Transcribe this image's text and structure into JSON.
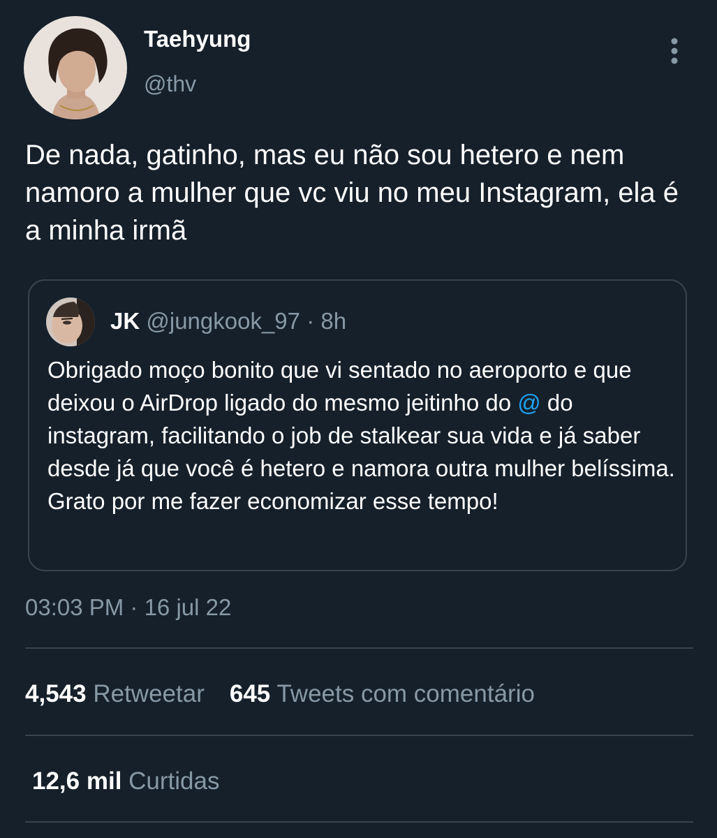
{
  "tweet": {
    "author": {
      "display_name": "Taehyung",
      "handle": "@thv",
      "avatar_icon": "profile-photo"
    },
    "menu_icon": "vertical-dots-icon",
    "text": "De nada, gatinho, mas eu não sou hetero e nem namoro a mulher que vc viu no meu Instagram, ela é a minha irmã",
    "timestamp": "03:03 PM · 16 jul 22"
  },
  "quoted_tweet": {
    "display_name": "JK",
    "handle": "@jungkook_97",
    "separator": "·",
    "time": "8h",
    "text_before_mention": "Obrigado moço bonito que vi sentado no aeroporto e que deixou o AirDrop ligado do mesmo jeitinho do ",
    "mention": "@",
    "text_after_mention": " do instagram, facilitando o job de stalkear sua vida e já saber desde já que você é hetero e namora outra mulher belíssima. Grato por me fazer economizar esse tempo!"
  },
  "stats": {
    "retweets_count": "4,543",
    "retweets_label": "Retweetar",
    "quotes_count": "645",
    "quotes_label": "Tweets com comentário",
    "likes_count": "12,6 mil",
    "likes_label": "Curtidas"
  },
  "colors": {
    "background": "#15202b",
    "text_primary": "#ffffff",
    "text_secondary": "#8899a6",
    "border": "#38444d",
    "link": "#1da1f2"
  }
}
